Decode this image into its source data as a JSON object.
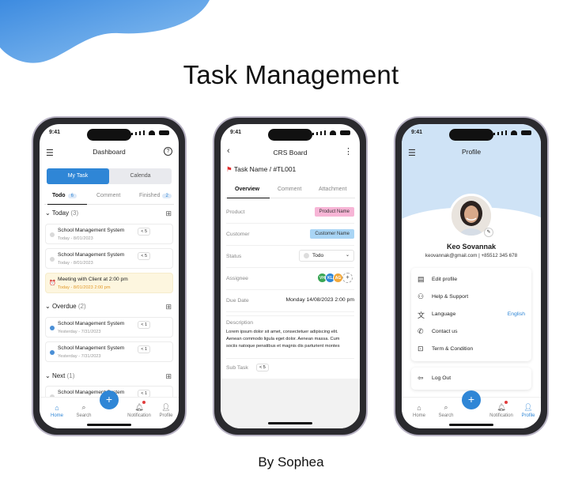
{
  "page": {
    "title": "Task Management",
    "byline": "By Sophea",
    "colors": {
      "primary": "#2f86d6",
      "profile_header": "#cfe3f6",
      "pink_tag": "#f7b5d6",
      "blue_tag": "#a9d5f5"
    }
  },
  "status_bar": {
    "time": "9:41"
  },
  "dashboard": {
    "title": "Dashboard",
    "menu_icon": "sort-icon",
    "help_icon": "help-circle-icon",
    "segment": {
      "active": "My Task",
      "inactive": "Calenda"
    },
    "tabs": [
      {
        "label": "Todo",
        "count": "6"
      },
      {
        "label": "Comment"
      },
      {
        "label": "Finished",
        "count": "2"
      }
    ],
    "sections": [
      {
        "name": "Today",
        "count": "(3)"
      },
      {
        "name": "Overdue",
        "count": "(2)"
      },
      {
        "name": "Next",
        "count": "(1)"
      }
    ],
    "tasks": [
      {
        "title": "School Management System",
        "date": "Today - 8/01/2023",
        "subtasks": "5"
      },
      {
        "title": "School Management System",
        "date": "Today - 8/01/2023",
        "subtasks": "5"
      },
      {
        "title": "Meeting with Client at 2:00 pm",
        "date": "Today - 8/01/2023 2:00 pm"
      },
      {
        "title": "School Management System",
        "date": "Yesterday - 7/31/2023",
        "subtasks": "1"
      },
      {
        "title": "School Management System",
        "date": "Yesterday - 7/31/2023",
        "subtasks": "1"
      },
      {
        "title": "School Management System",
        "subtasks": "1"
      }
    ],
    "nav": [
      "Home",
      "Search",
      "Notification",
      "Profile"
    ]
  },
  "crs": {
    "title": "CRS Board",
    "task_name": "Task Name / #TL001",
    "tabs": [
      "Overview",
      "Comment",
      "Attachment"
    ],
    "product": {
      "label": "Product",
      "value": "Product Name"
    },
    "customer": {
      "label": "Customer",
      "value": "Customer Name"
    },
    "status": {
      "label": "Status",
      "value": "Todo"
    },
    "assignee": {
      "label": "Assignee",
      "avatars": [
        "VH",
        "KL",
        "AG"
      ]
    },
    "due": {
      "label": "Due Date",
      "value": "Monday 14/08/2023 2:00 pm"
    },
    "description": {
      "label": "Description",
      "lines": [
        "Lorem ipsum dolor sit amet, consectetuer adipiscing elit.",
        "Aenean commodo ligula eget dolor. Aenean massa. Cum",
        "sociis natoque penatibus et magnis dis parturient montes"
      ]
    },
    "subtask": {
      "label": "Sub Task",
      "count": "5"
    }
  },
  "profile": {
    "title": "Profile",
    "name": "Keo Sovannak",
    "contact": "keovannak@gmail.com | +85512 345 678",
    "menu": [
      {
        "label": "Edit profile",
        "icon": "id-card-icon"
      },
      {
        "label": "Help & Support",
        "icon": "user-help-icon"
      },
      {
        "label": "Language",
        "icon": "translate-icon",
        "value": "English"
      },
      {
        "label": "Contact us",
        "icon": "phone-icon"
      },
      {
        "label": "Term & Condition",
        "icon": "lock-icon"
      }
    ],
    "logout": "Log Out",
    "nav": [
      "Home",
      "Search",
      "Notification",
      "Profile"
    ]
  }
}
